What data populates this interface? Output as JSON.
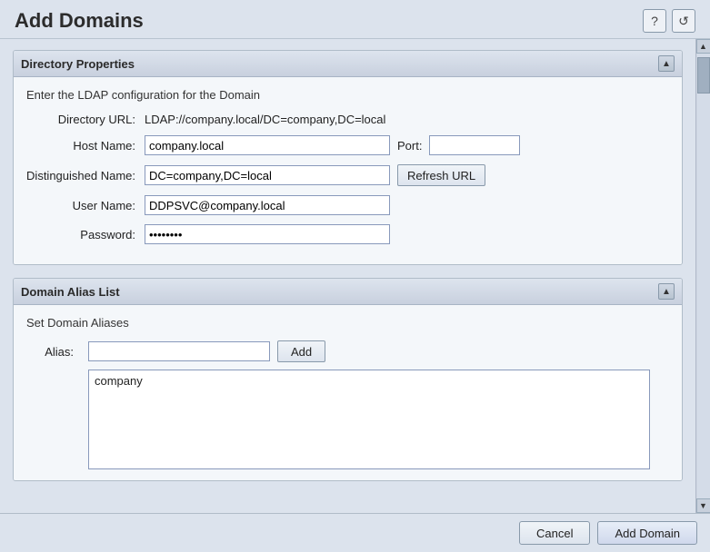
{
  "header": {
    "title": "Add Domains",
    "help_icon": "?",
    "refresh_icon": "↺"
  },
  "directory_properties": {
    "panel_title": "Directory Properties",
    "subtitle": "Enter the LDAP configuration for the Domain",
    "fields": {
      "directory_url_label": "Directory URL:",
      "directory_url_value": "LDAP://company.local/DC=company,DC=local",
      "host_name_label": "Host Name:",
      "host_name_value": "company.local",
      "port_label": "Port:",
      "port_value": "",
      "distinguished_name_label": "Distinguished Name:",
      "distinguished_name_value": "DC=company,DC=local",
      "refresh_url_label": "Refresh URL",
      "user_name_label": "User Name:",
      "user_name_value": "DDPSVC@company.local",
      "password_label": "Password:",
      "password_value": "••••••••"
    }
  },
  "domain_alias_list": {
    "panel_title": "Domain Alias List",
    "subtitle": "Set Domain Aliases",
    "alias_label": "Alias:",
    "alias_input_value": "",
    "alias_input_placeholder": "",
    "add_button_label": "Add",
    "aliases": [
      "company"
    ]
  },
  "footer": {
    "cancel_label": "Cancel",
    "add_domain_label": "Add Domain"
  }
}
